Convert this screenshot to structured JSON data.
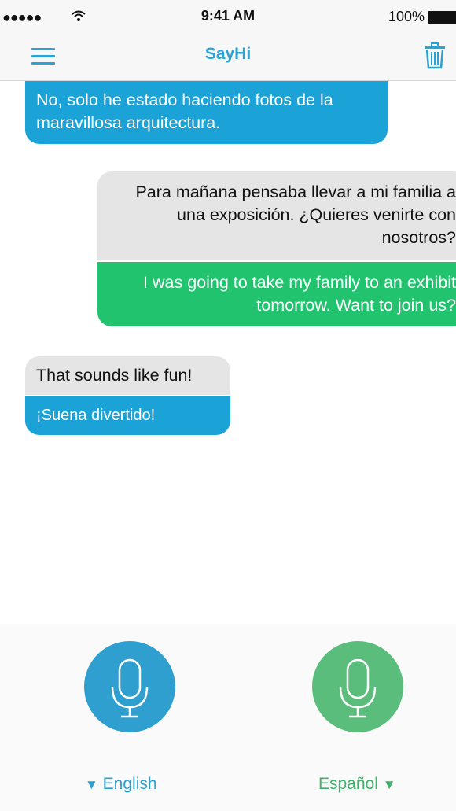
{
  "status_bar": {
    "signal": "●●●●●",
    "time": "9:41 AM",
    "battery": "100%"
  },
  "nav": {
    "title": "SayHi",
    "menu_icon": "hamburger-menu-icon",
    "trash_icon": "trash-icon"
  },
  "messages": [
    {
      "side": "left",
      "lang": "es",
      "text": "No, solo he estado haciendo fotos de la maravillosa arquitectura."
    },
    {
      "side": "right",
      "lang": "es",
      "text": "Para mañana pensaba llevar a mi familia a una exposición. ¿Quieres venirte con nosotros?"
    },
    {
      "side": "right",
      "lang": "en",
      "text": "I was going to take my family to an exhibit tomorrow. Want to join us?"
    },
    {
      "side": "left",
      "lang": "en",
      "text": "That sounds like fun!"
    },
    {
      "side": "left",
      "lang": "es",
      "text": "¡Suena divertido!"
    }
  ],
  "controls": {
    "left_language": "English",
    "right_language": "Español",
    "left_arrow": "▼",
    "right_arrow": "▼",
    "mic_icon": "microphone-icon"
  },
  "colors": {
    "blue": "#1ba3d8",
    "green": "#22c36f",
    "gray": "#e5e5e5",
    "mic_blue": "#2f9fd0",
    "mic_green": "#5bbd7b"
  }
}
